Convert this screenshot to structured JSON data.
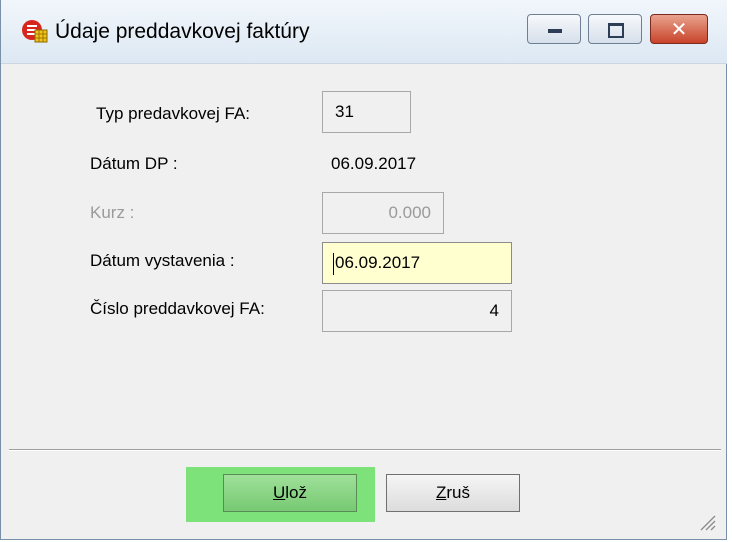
{
  "window": {
    "title": "Údaje preddavkovej faktúry",
    "close_glyph": "✕"
  },
  "form": {
    "typ_label": "Typ predavkovej FA:",
    "typ_value": "31",
    "datum_dp_label": "Dátum DP :",
    "datum_dp_value": "06.09.2017",
    "kurz_label": "Kurz :",
    "kurz_value": "0.000",
    "datum_vyst_label": "Dátum vystavenia :",
    "datum_vyst_value": "06.09.2017",
    "cislo_label": "Číslo preddavkovej FA:",
    "cislo_value": "4"
  },
  "buttons": {
    "ok_first": "U",
    "ok_rest": "lož",
    "cancel_first": "Z",
    "cancel_rest": "ruš"
  },
  "colors": {
    "active_field": "#ffffd0",
    "ok_highlight": "#7de27a"
  }
}
